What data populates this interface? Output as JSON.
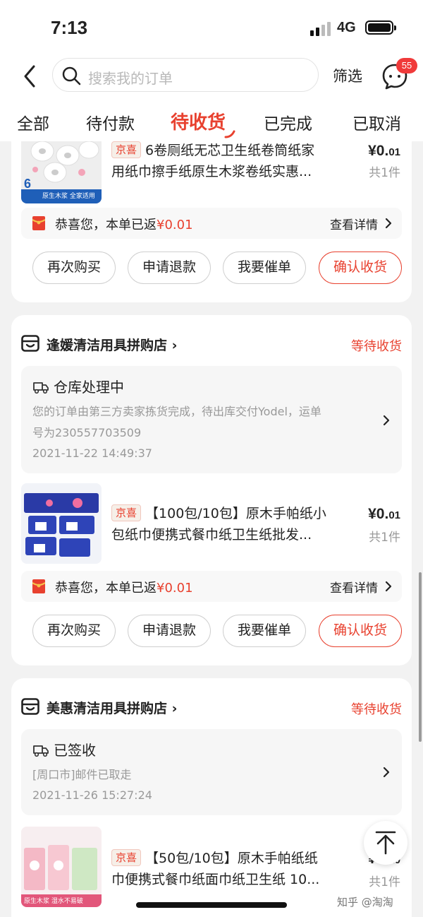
{
  "status_bar": {
    "time": "7:13",
    "network": "4G"
  },
  "header": {
    "search_placeholder": "搜索我的订单",
    "filter_label": "筛选",
    "message_badge": "55"
  },
  "tabs": [
    {
      "label": "全部",
      "active": false
    },
    {
      "label": "待付款",
      "active": false
    },
    {
      "label": "待收货",
      "active": true
    },
    {
      "label": "已完成",
      "active": false
    },
    {
      "label": "已取消",
      "active": false
    }
  ],
  "orders": [
    {
      "tag": "京喜",
      "product_line1": "6卷厕纸无芯卫生纸卷筒纸家",
      "product_line2": "用纸巾擦手纸原生木浆卷纸实惠...",
      "thumb_text": "原生木浆 全家适用",
      "price_int": "¥0.",
      "price_dec": "01",
      "qty": "共1件",
      "rebate_text": "恭喜您，本单已返",
      "rebate_amount": "¥0.01",
      "rebate_detail": "查看详情",
      "buttons": [
        "再次购买",
        "申请退款",
        "我要催单",
        "确认收货"
      ]
    },
    {
      "shop_name": "逢媛清洁用具拼购店",
      "status": "等待收货",
      "logistics_title": "仓库处理中",
      "logistics_line1": "您的订单由第三方卖家拣货完成，待出库交付Yodel，运单",
      "logistics_line2": "号为230557703509",
      "logistics_time": "2021-11-22 14:49:37",
      "tag": "京喜",
      "product_line1": "【100包/10包】原木手帕纸小",
      "product_line2": "包纸巾便携式餐巾纸卫生纸批发...",
      "price_int": "¥0.",
      "price_dec": "01",
      "qty": "共1件",
      "rebate_text": "恭喜您，本单已返",
      "rebate_amount": "¥0.01",
      "rebate_detail": "查看详情",
      "buttons": [
        "再次购买",
        "申请退款",
        "我要催单",
        "确认收货"
      ]
    },
    {
      "shop_name": "美惠清洁用具拼购店",
      "status": "等待收货",
      "logistics_title": "已签收",
      "logistics_line1": "[周口市]邮件已取走",
      "logistics_time": "2021-11-26 15:27:24",
      "tag": "京喜",
      "product_line1": "【50包/10包】原木手帕纸纸",
      "product_line2": "巾便携式餐巾纸面巾纸卫生纸 10...",
      "thumb_text": "原生木浆 湿水不易破",
      "price_int": "¥0.",
      "price_dec": "10",
      "qty": "共1件"
    }
  ],
  "watermark": "知乎 @淘淘"
}
